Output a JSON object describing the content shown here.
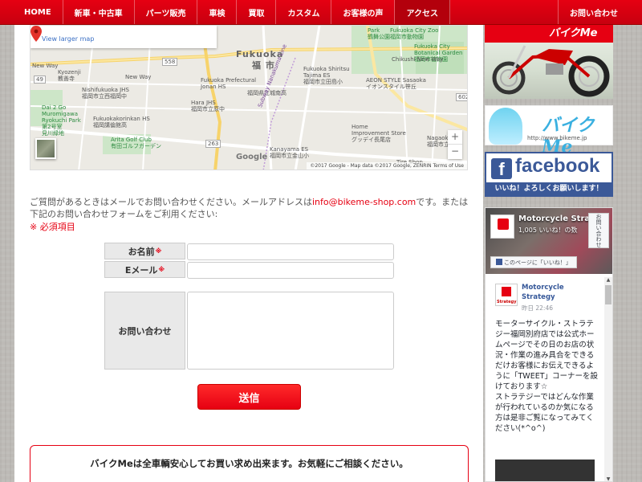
{
  "nav": {
    "items": [
      "HOME",
      "新車・中古車",
      "パーツ販売",
      "車検",
      "買取",
      "カスタム",
      "お客様の声",
      "アクセス"
    ],
    "contact": "お問い合わせ",
    "accent": "#e60012"
  },
  "map": {
    "view_larger": "View larger map",
    "labels": {
      "fukuoka_en": "Fukuoka",
      "fukuoka_jp": "福 市",
      "pref_jonan": "Fukuoka Prefectural\nJonan HS",
      "pref_jonan_jp": "福岡県立城南高",
      "nishi_jhs": "Nishifukuoka JHS\n福岡市立西福岡中",
      "kyozenji": "Kyozenji\n教善寺",
      "new_way": "New Way",
      "new_way2": "New Way",
      "dai2go": "Dai 2 Go\nMuromigawa\nRyokuchi Park\n第2号室\n見川緑地",
      "korinkan": "Fukuokakorinkan HS\n福岡講倫館高",
      "hara": "Hara JHS\n福岡市立原中",
      "arita": "Arita Golf Club\n有田ゴルフガーデン",
      "shiritsu": "Fukuoka Shiritsu\nTajima ES\n福岡市立田島小",
      "aeon": "AEON STYLE Sasaoka\nイオンスタイル笹丘",
      "kanayama": "Kanayama ES\n福岡市立金山小",
      "home_imp": "Home\nImprovement Store\nグッデイ長尾店",
      "city_zoo": "Fukuoka City Zoo\n福岡市動物園",
      "botanical": "Fukuoka City\nBotanical Garden\n福岡市植物園",
      "chikushi": "Chikushi New Way",
      "nagaoka": "Nagaok\n福岡市立",
      "tire_shop": "Tire Shop",
      "park": "Park\n鶴舞公園",
      "subway": "Subway Nanakuma Line",
      "r558": "558",
      "r49": "49",
      "r263": "263",
      "r602": "602"
    },
    "zoom_in": "+",
    "zoom_out": "−",
    "google": "Google",
    "attribution": "©2017 Google - Map data ©2017 Google, ZENRIN   Terms of Use"
  },
  "intro": {
    "before_email": "ご質問があるときはメールでお問い合わせください。メールアドレスは",
    "email": "info@bikeme-shop.com",
    "after_email": "です。または下記のお問い合わせフォームをご利用ください:"
  },
  "required_note": "※ 必須項目",
  "form": {
    "name_label": "お名前",
    "email_label": "Eメール",
    "message_label": "お問い合わせ",
    "required_mark": "※",
    "name_value": "",
    "email_value": "",
    "message_value": "",
    "submit": "送信"
  },
  "notice": "バイクMeは全車輌安心してお買い求め出来ます。お気軽にご相談ください。",
  "sidebar": {
    "top_banner_text": "バイクMe",
    "bikeme_logo": "バイクMe",
    "bikeme_url": "http://www.bikeme.jp",
    "fb_word": "facebook",
    "fb_sub": "いいね！よろしくお願いします！",
    "fb_page_name": "Motorcycle Strat...",
    "fb_likes": "1,005 いいね！の数",
    "fb_contact": "お問い合わせ",
    "fb_like_page": "このページに「いいね！」",
    "post_logo_text": "Strategy",
    "post_name": "Motorcycle Strategy",
    "post_time": "昨日 22:46",
    "post_text": "モーターサイクル・ストラテジー福岡別府店では公式ホームページでその日のお店の状況・作業の進み具合をできるだけお客様にお伝えできるように「TWEET」コーナーを設けております☆\nストラテジーではどんな作業が行われているのか気になる方は是非ご覧になってみてください(*^o^)",
    "scroll_up": "▲",
    "scroll_down": "▼"
  }
}
